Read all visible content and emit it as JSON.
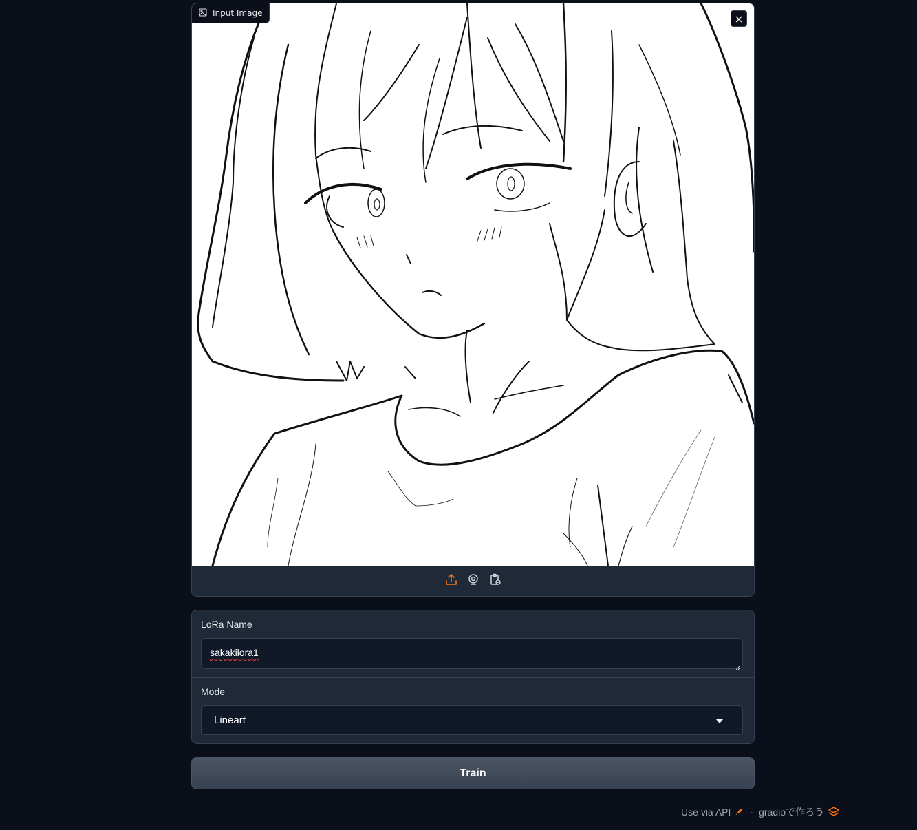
{
  "image_component": {
    "label": "Input Image",
    "label_icon": "image-icon",
    "close_icon": "close-icon",
    "toolbar": {
      "upload_icon": "upload-icon",
      "webcam_icon": "webcam-icon",
      "clipboard_icon": "clipboard-icon",
      "accent": "#f97316"
    },
    "image_alt": "Anime girl lineart sketch"
  },
  "form": {
    "lora_name": {
      "label": "LoRa Name",
      "value": "sakakilora1"
    },
    "mode": {
      "label": "Mode",
      "value": "Lineart"
    }
  },
  "train_button": {
    "label": "Train"
  },
  "footer": {
    "api_link": "Use via API",
    "separator": "·",
    "built_with": "gradioで作ろう"
  },
  "colors": {
    "background": "#0b0f19",
    "panel": "#1f2937",
    "border": "#374151",
    "input_bg": "#111827",
    "accent": "#f97316"
  }
}
